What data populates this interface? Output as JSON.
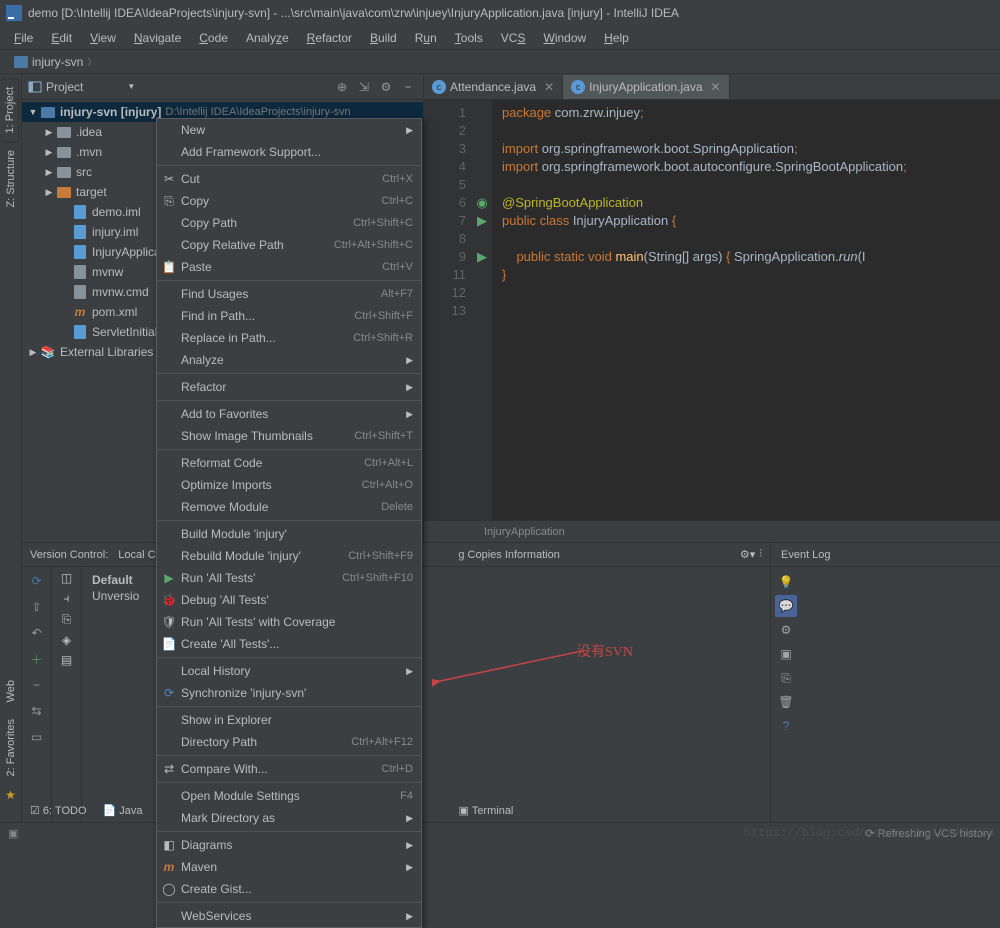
{
  "window": {
    "title": "demo [D:\\Intellij IDEA\\IdeaProjects\\injury-svn] - ...\\src\\main\\java\\com\\zrw\\injuey\\InjuryApplication.java [injury] - IntelliJ IDEA"
  },
  "menu": {
    "file": "File",
    "edit": "Edit",
    "view": "View",
    "navigate": "Navigate",
    "code": "Code",
    "analyze": "Analyze",
    "refactor": "Refactor",
    "build": "Build",
    "run": "Run",
    "tools": "Tools",
    "vcs": "VCS",
    "window": "Window",
    "help": "Help"
  },
  "breadcrumb": {
    "root": "injury-svn"
  },
  "left_tabs": {
    "project": "1: Project",
    "structure": "Z: Structure",
    "web": "Web",
    "favorites": "2: Favorites"
  },
  "project_header": {
    "label": "Project"
  },
  "tree": {
    "root": "injury-svn",
    "root_suffix": "[injury]",
    "root_path": "D:\\Intellij IDEA\\IdeaProjects\\injury-svn",
    "nodes": {
      "idea": ".idea",
      "mvn": ".mvn",
      "src": "src",
      "target": "target",
      "demo_iml": "demo.iml",
      "injury_iml": "injury.iml",
      "injury_app": "InjuryApplica",
      "mvnw": "mvnw",
      "mvnw_cmd": "mvnw.cmd",
      "pom": "pom.xml",
      "servlet": "ServletInitiali",
      "ext_libs": "External Libraries"
    }
  },
  "editor_tabs": {
    "tab1": "Attendance.java",
    "tab2": "InjuryApplication.java"
  },
  "code": {
    "l1": "package com.zrw.injuey;",
    "l3": "import org.springframework.boot.SpringApplication;",
    "l4_a": "import org.springframework.boot.autoconfigure.",
    "l4_b": "SpringBootApplication",
    "l6": "@SpringBootApplication",
    "l7_a": "public class ",
    "l7_b": "InjuryApplication",
    "l7_c": " {",
    "l9_a": "public static void ",
    "l9_b": "main",
    "l9_c": "(String[] args) { SpringApplication.",
    "l9_d": "run",
    "l9_e": "(I",
    "l11": "}"
  },
  "editor_breadcrumb": "InjuryApplication",
  "vcs": {
    "header_left": "Version Control:",
    "tab_local": "Local Ch",
    "tab_default": "Default",
    "tab_unversion": "Unversio",
    "wc_info": "g Copies Information"
  },
  "event_log": {
    "title": "Event Log"
  },
  "context_menu": {
    "new": "New",
    "framework": "Add Framework Support...",
    "cut": "Cut",
    "cut_sc": "Ctrl+X",
    "copy": "Copy",
    "copy_sc": "Ctrl+C",
    "copy_path": "Copy Path",
    "copy_path_sc": "Ctrl+Shift+C",
    "copy_rel": "Copy Relative Path",
    "copy_rel_sc": "Ctrl+Alt+Shift+C",
    "paste": "Paste",
    "paste_sc": "Ctrl+V",
    "find_usages": "Find Usages",
    "find_usages_sc": "Alt+F7",
    "find_in_path": "Find in Path...",
    "find_in_path_sc": "Ctrl+Shift+F",
    "replace_in_path": "Replace in Path...",
    "replace_in_path_sc": "Ctrl+Shift+R",
    "analyze": "Analyze",
    "refactor": "Refactor",
    "add_fav": "Add to Favorites",
    "show_thumb": "Show Image Thumbnails",
    "show_thumb_sc": "Ctrl+Shift+T",
    "reformat": "Reformat Code",
    "reformat_sc": "Ctrl+Alt+L",
    "optimize": "Optimize Imports",
    "optimize_sc": "Ctrl+Alt+O",
    "remove_mod": "Remove Module",
    "remove_mod_sc": "Delete",
    "build_mod": "Build Module 'injury'",
    "rebuild_mod": "Rebuild Module 'injury'",
    "rebuild_mod_sc": "Ctrl+Shift+F9",
    "run_all": "Run 'All Tests'",
    "run_all_sc": "Ctrl+Shift+F10",
    "debug_all": "Debug 'All Tests'",
    "cov_all": "Run 'All Tests' with Coverage",
    "create_tests": "Create 'All Tests'...",
    "local_hist": "Local History",
    "sync": "Synchronize 'injury-svn'",
    "show_exp": "Show in Explorer",
    "dir_path": "Directory Path",
    "dir_path_sc": "Ctrl+Alt+F12",
    "compare": "Compare With...",
    "compare_sc": "Ctrl+D",
    "mod_settings": "Open Module Settings",
    "mod_settings_sc": "F4",
    "mark_dir": "Mark Directory as",
    "diagrams": "Diagrams",
    "maven": "Maven",
    "gist": "Create Gist...",
    "webservices": "WebServices"
  },
  "bottom_tabs": {
    "todo": "6: TODO",
    "java": "Java",
    "terminal": "Terminal"
  },
  "status": {
    "vcs": "Refreshing VCS history"
  },
  "annotation": {
    "no_svn": "没有SVN"
  },
  "watermark": "https://blog.csdn.net/wang124454731"
}
